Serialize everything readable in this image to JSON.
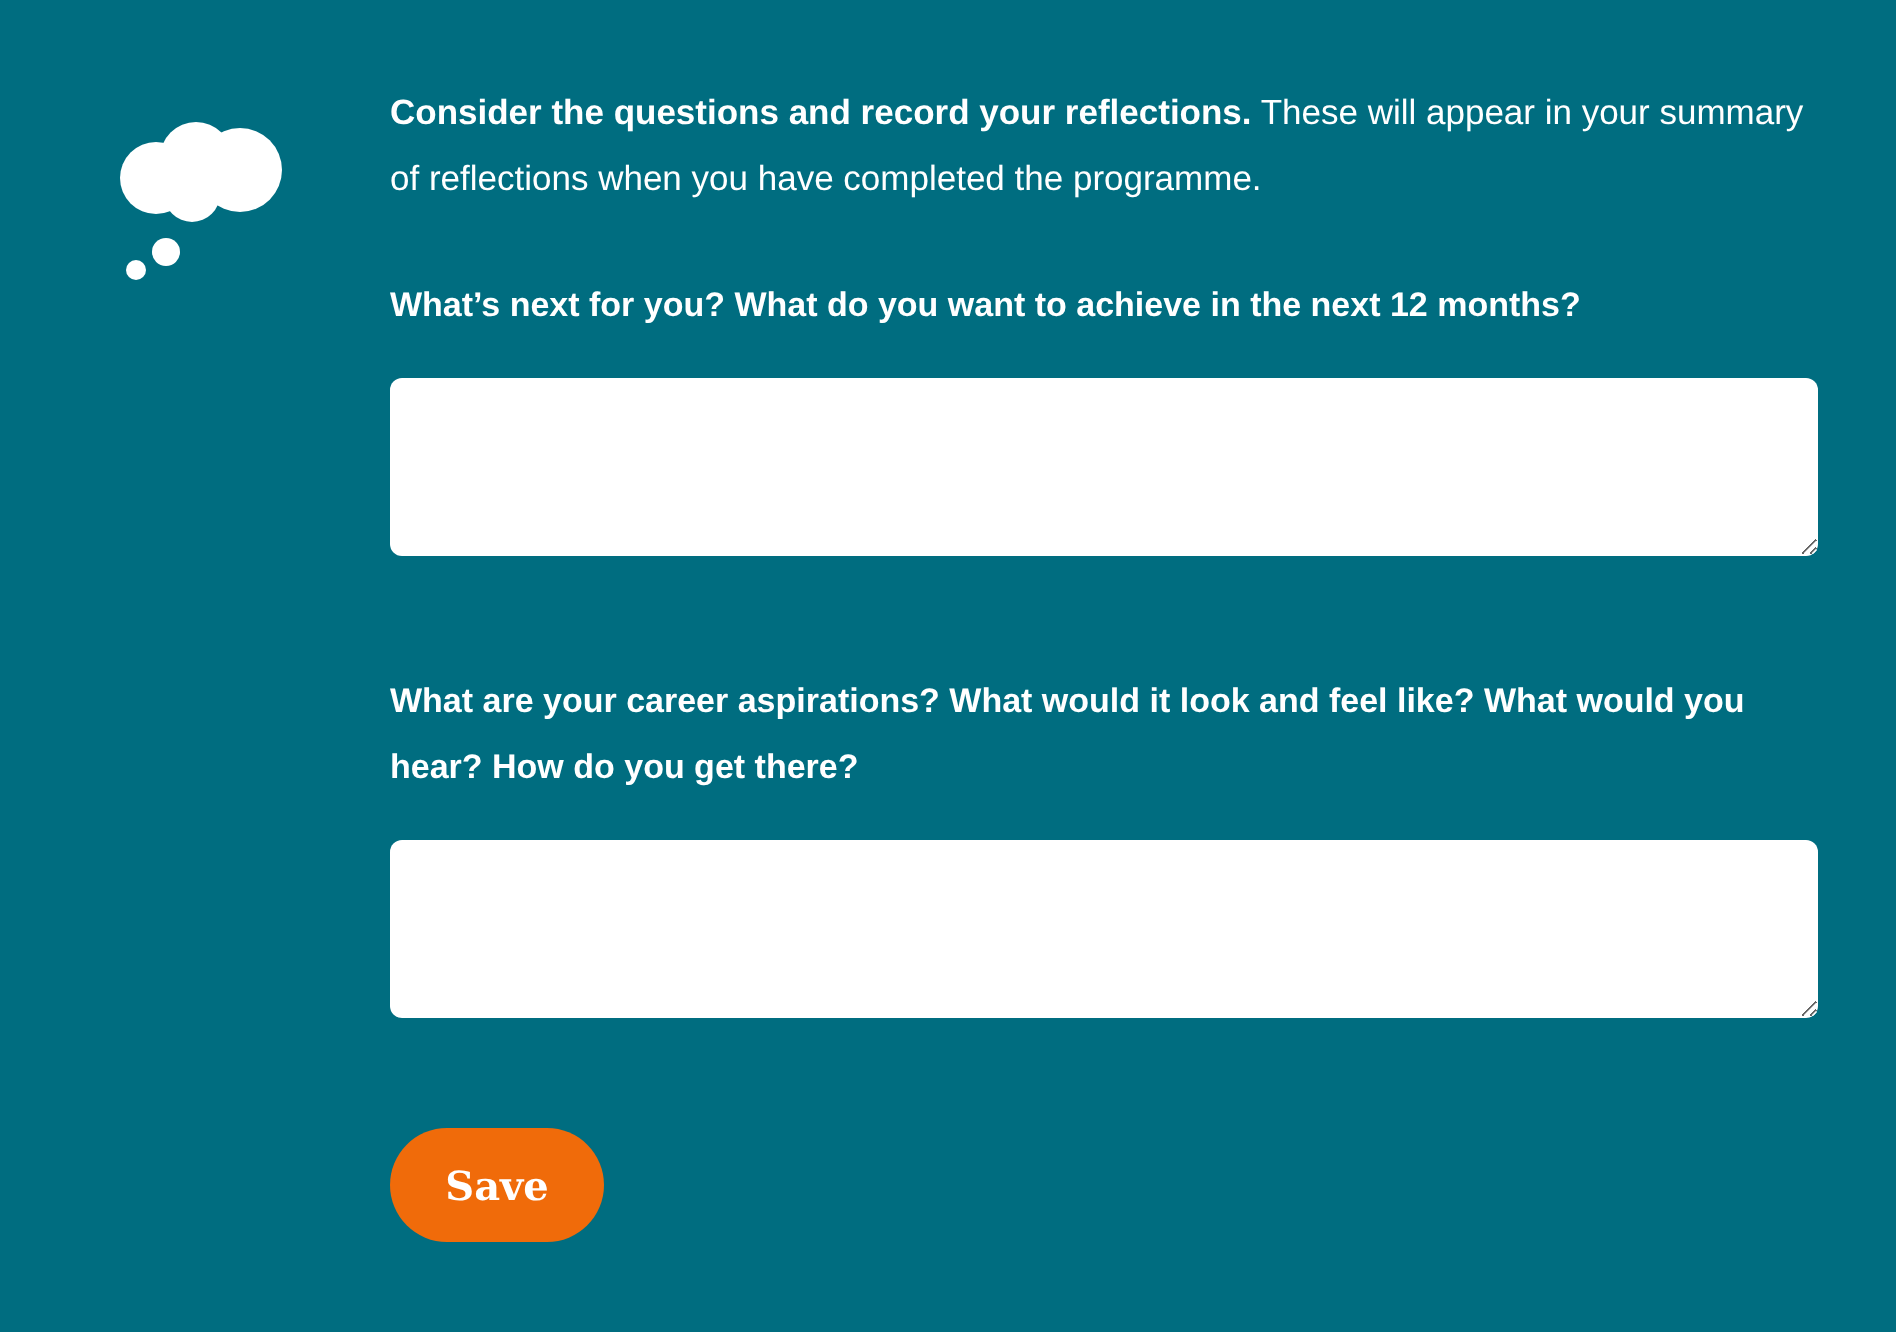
{
  "intro": "**Consider the questions and record your reflections.** These will appear in your summary of reflections when you have completed the programme.",
  "questions": [
    {
      "label": "What’s next for you? What do you want to achieve in the next 12 months?"
    },
    {
      "label": "What are your career aspirations? What would it look and feel like? What would you hear? How do you get there?"
    }
  ],
  "save_button": {
    "label": "Save"
  }
}
